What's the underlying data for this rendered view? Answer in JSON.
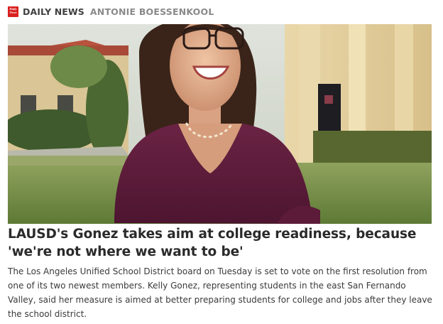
{
  "source": {
    "name": "DAILY NEWS",
    "logo_text": "Daily News",
    "logo_color": "#d9201f"
  },
  "author": "ANTONIE BOESSENKOOL",
  "image": {
    "description_icon": "article-photo"
  },
  "article": {
    "headline": "LAUSD's Gonez takes aim at college readiness, because 'we're not where we want to be'",
    "summary": "The Los Angeles Unified School District board on Tuesday is set to vote on the first resolution from one of its two newest members. Kelly Gonez, representing students in the east San Fernando Valley, said her measure is aimed at better preparing students for college and jobs after they leave the school district."
  }
}
